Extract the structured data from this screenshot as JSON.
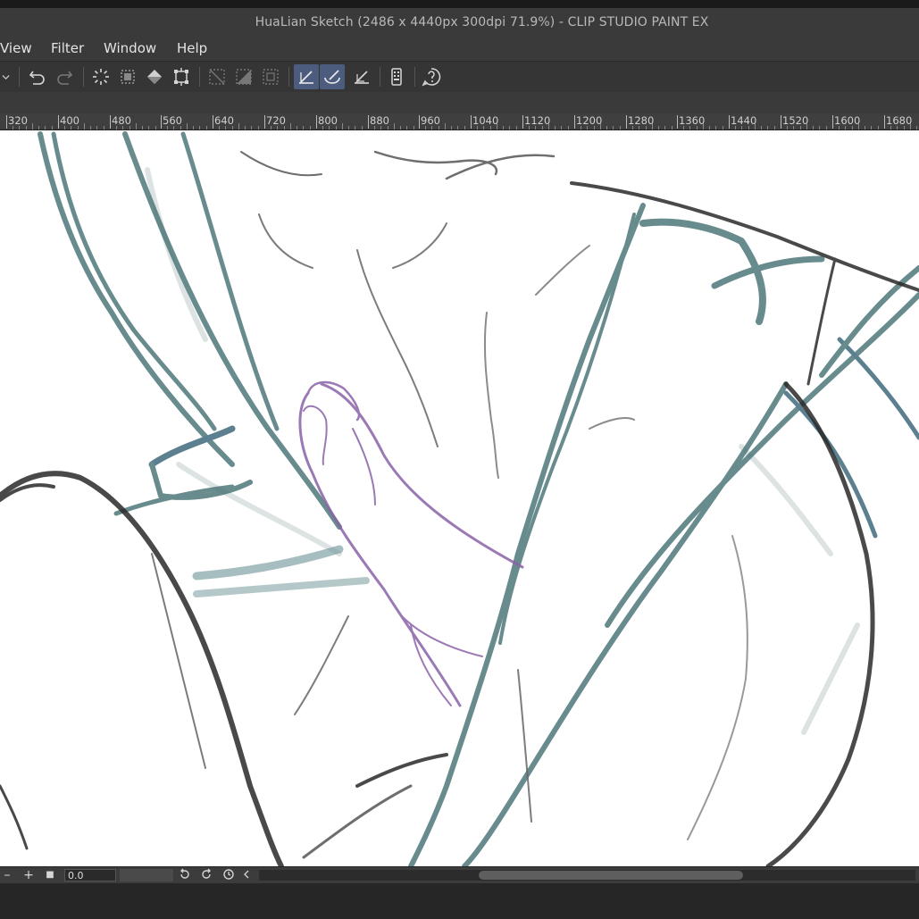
{
  "window": {
    "title": "HuaLian Sketch (2486 x 4440px 300dpi 71.9%)  - CLIP STUDIO PAINT EX"
  },
  "menu": {
    "items": [
      "View",
      "Filter",
      "Window",
      "Help"
    ]
  },
  "toolbar": {
    "buttons": [
      {
        "name": "dropdown-icon"
      },
      {
        "name": "undo-icon"
      },
      {
        "name": "redo-icon"
      },
      {
        "name": "clear-selection-icon"
      },
      {
        "name": "select-all-icon"
      },
      {
        "name": "fill-icon"
      },
      {
        "name": "transform-icon"
      },
      {
        "name": "invert-selection-icon"
      },
      {
        "name": "crop-icon"
      },
      {
        "name": "expand-selection-icon"
      },
      {
        "name": "snap-ruler-icon",
        "active": true
      },
      {
        "name": "snap-special-ruler-icon",
        "active": true
      },
      {
        "name": "snap-grid-icon"
      },
      {
        "name": "device-settings-icon"
      },
      {
        "name": "help-icon"
      }
    ]
  },
  "ruler": {
    "labels": [
      "320",
      "400",
      "480",
      "560",
      "640",
      "720",
      "800",
      "880",
      "960",
      "1040",
      "1120",
      "1200",
      "1280",
      "1360",
      "1440",
      "1520",
      "1600",
      "1680"
    ]
  },
  "statusbar": {
    "zoom_out": "–",
    "zoom_in": "+",
    "fit": "■",
    "zoom_value": "0.0"
  },
  "colors": {
    "teal_stroke": "#4d7779",
    "black_stroke": "#2a2a2a",
    "purple_stroke": "#8a62a8",
    "active_button": "#4c5c7e"
  }
}
